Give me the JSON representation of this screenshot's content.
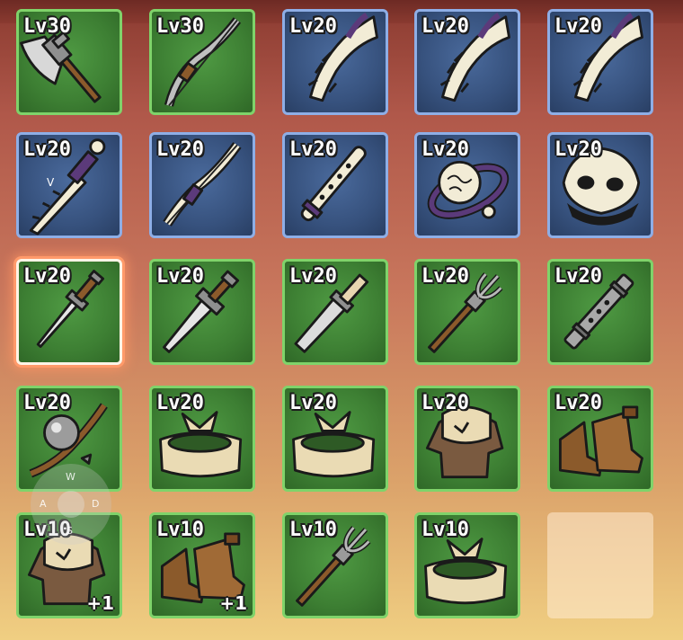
{
  "inventory": {
    "rows": [
      [
        {
          "level": "Lv30",
          "frame": "green",
          "item": "battle-axe"
        },
        {
          "level": "Lv30",
          "frame": "green",
          "item": "recurve-bow"
        },
        {
          "level": "Lv20",
          "frame": "blue",
          "item": "bone-blade"
        },
        {
          "level": "Lv20",
          "frame": "blue",
          "item": "bone-blade"
        },
        {
          "level": "Lv20",
          "frame": "blue",
          "item": "bone-blade"
        }
      ],
      [
        {
          "level": "Lv20",
          "frame": "blue",
          "item": "bone-sword"
        },
        {
          "level": "Lv20",
          "frame": "blue",
          "item": "bone-bow"
        },
        {
          "level": "Lv20",
          "frame": "blue",
          "item": "bone-flute"
        },
        {
          "level": "Lv20",
          "frame": "blue",
          "item": "brain-orb"
        },
        {
          "level": "Lv20",
          "frame": "blue",
          "item": "bone-mask"
        }
      ],
      [
        {
          "level": "Lv20",
          "frame": "green",
          "item": "dagger",
          "selected": true
        },
        {
          "level": "Lv20",
          "frame": "green",
          "item": "broadsword"
        },
        {
          "level": "Lv20",
          "frame": "green",
          "item": "short-sword"
        },
        {
          "level": "Lv20",
          "frame": "green",
          "item": "trident-spear"
        },
        {
          "level": "Lv20",
          "frame": "green",
          "item": "iron-flute"
        }
      ],
      [
        {
          "level": "Lv20",
          "frame": "green",
          "item": "orb-amulet"
        },
        {
          "level": "Lv20",
          "frame": "green",
          "item": "cloth-headband"
        },
        {
          "level": "Lv20",
          "frame": "green",
          "item": "cloth-headband"
        },
        {
          "level": "Lv20",
          "frame": "green",
          "item": "cloth-tunic"
        },
        {
          "level": "Lv20",
          "frame": "green",
          "item": "leather-boots"
        }
      ],
      [
        {
          "level": "Lv10",
          "frame": "green",
          "item": "cloth-tunic",
          "plus": "+1"
        },
        {
          "level": "Lv10",
          "frame": "green",
          "item": "leather-boots",
          "plus": "+1"
        },
        {
          "level": "Lv10",
          "frame": "green",
          "item": "trident-spear"
        },
        {
          "level": "Lv10",
          "frame": "green",
          "item": "cloth-headband"
        },
        {
          "level": "",
          "frame": "empty",
          "item": ""
        }
      ]
    ]
  },
  "controls": {
    "joystick_up_key": "W",
    "joystick_left_key": "A",
    "joystick_right_key": "D",
    "joystick_down_key": "S",
    "weapon_hotkey": "V"
  },
  "colors": {
    "common_frame": "#7fd36a",
    "rare_frame": "#8eaee6",
    "selected_glow": "#ff9a6a"
  }
}
